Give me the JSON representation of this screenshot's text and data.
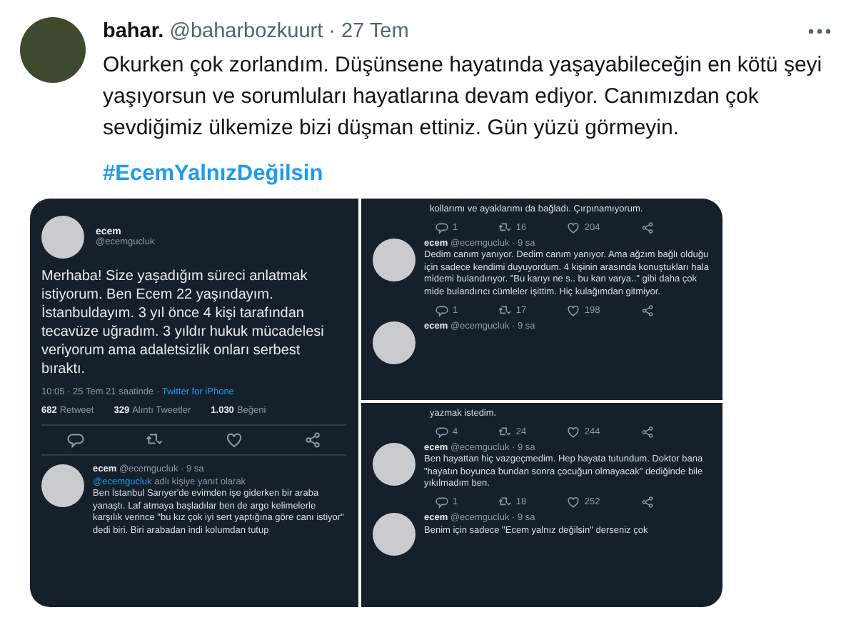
{
  "tweet": {
    "author": "bahar.",
    "handle": "@baharbozkuurt",
    "separator": "·",
    "date": "27 Tem",
    "text": "Okurken çok zorlandım. Düşünsene hayatında yaşayabileceğin en kötü şeyi yaşıyorsun ve sorumluları hayatlarına devam ediyor. Canımızdan çok sevdiğimiz ülkemize bizi düşman ettiniz. Gün yüzü görmeyin.",
    "hashtag": "#EcemYalnızDeğilsin"
  },
  "media": [
    {
      "items": [
        {
          "kind": "main",
          "name": "ecem",
          "handle": "@ecemgucluk",
          "text": "Merhaba! Size yaşadığım süreci anlatmak istiyorum. Ben Ecem 22 yaşındayım. İstanbuldayım. 3 yıl önce 4 kişi tarafından tecavüze uğradım. 3 yıldır hukuk mücadelesi veriyorum ama adaletsizlik onları serbest bıraktı.",
          "meta": "10:05 · 25 Tem 21 saatinde ·",
          "source": "Twitter for iPhone",
          "stats": [
            {
              "value": "682",
              "label": "Retweet"
            },
            {
              "value": "329",
              "label": "Alıntı Tweetler"
            },
            {
              "value": "1.030",
              "label": "Beğeni"
            }
          ]
        },
        {
          "kind": "actions"
        },
        {
          "kind": "reply",
          "name": "ecem",
          "handle": "@ecemgucluk · 9 sa",
          "reply_to": "@ecemgucluk",
          "reply_note": "adlı kişiye yanıt olarak",
          "text": "Ben İstanbul Sarıyer'de evimden işe giderken bir araba yanaştı. Laf atmaya başladılar ben de argo kelimelerle karşılık verince \"bu kız çok iyi sert yaptığına göre canı istiyor\" dedi biri. Biri arabadan indi kolumdan tutup"
        }
      ]
    },
    {
      "items": [
        {
          "kind": "fragment",
          "text": "kollarımı ve ayaklarımı da bağladı. Çırpınamıyorum."
        },
        {
          "kind": "actions",
          "counts": [
            "1",
            "16",
            "204"
          ]
        },
        {
          "kind": "reply",
          "name": "ecem",
          "handle": "@ecemgucluk · 9 sa",
          "text": "Dedim canım yanıyor. Dedim canım yanıyor. Ama ağzım bağlı olduğu için sadece kendimi duyuyordum. 4 kişinin arasında konuştukları hala midemi bulandırıyor. \"Bu karıyı ne s.. bu kan varya..\" gibi daha çok mide bulandırıcı cümleler işittim. Hiç kulağımdan gitmiyor."
        },
        {
          "kind": "actions",
          "counts": [
            "1",
            "17",
            "198"
          ]
        },
        {
          "kind": "reply",
          "name": "ecem",
          "handle": "@ecemgucluk · 9 sa"
        }
      ]
    },
    {
      "items": [
        {
          "kind": "fragment",
          "text": "yazmak istedim."
        },
        {
          "kind": "actions",
          "counts": [
            "4",
            "24",
            "244"
          ]
        },
        {
          "kind": "reply",
          "name": "ecem",
          "handle": "@ecemgucluk · 9 sa",
          "text": "Ben hayattan hiç vazgeçmedim. Hep hayata tutundum. Doktor bana \"hayatın boyunca bundan sonra çocuğun olmayacak\" dediğinde bile yıkılmadım ben."
        },
        {
          "kind": "actions",
          "counts": [
            "1",
            "18",
            "252"
          ]
        },
        {
          "kind": "reply",
          "name": "ecem",
          "handle": "@ecemgucluk · 9 sa",
          "text": "Benim için sadece \"Ecem yalnız değilsin\" derseniz çok"
        }
      ]
    }
  ]
}
